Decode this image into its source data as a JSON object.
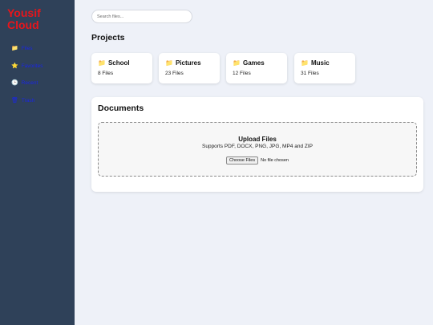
{
  "app": {
    "brand": "Yousif Cloud"
  },
  "sidebar": {
    "items": [
      {
        "icon": "📁",
        "label": "Files"
      },
      {
        "icon": "⭐",
        "label": "Favorites"
      },
      {
        "icon": "🕒",
        "label": "Recent"
      },
      {
        "icon": "🗑",
        "label": "Trash"
      }
    ]
  },
  "search": {
    "placeholder": "Search files..."
  },
  "projects": {
    "heading": "Projects",
    "cards": [
      {
        "icon": "📁",
        "title": "School",
        "count": "8 Files"
      },
      {
        "icon": "📁",
        "title": "Pictures",
        "count": "23 Files"
      },
      {
        "icon": "📁",
        "title": "Games",
        "count": "12 Files"
      },
      {
        "icon": "📁",
        "title": "Music",
        "count": "31 Files"
      }
    ]
  },
  "documents": {
    "heading": "Documents",
    "upload_title": "Upload Files",
    "upload_support": "Supports PDF, DOCX, PNG, JPG, MP4 and ZIP",
    "choose_label": "Choose Files",
    "no_file": "No file chosen"
  }
}
